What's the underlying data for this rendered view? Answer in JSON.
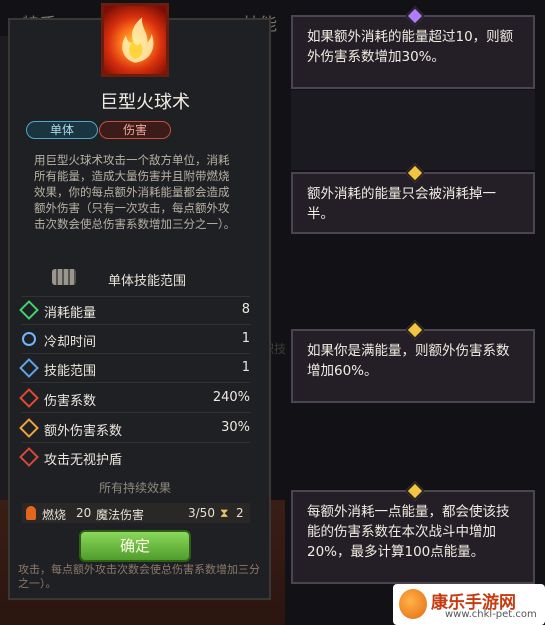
{
  "background": {
    "tab_left": "特质",
    "tab_right": "技能",
    "ghost_text_1": "未次",
    "ghost_text_2": "积技"
  },
  "skill": {
    "icon": "fireball-icon",
    "title": "巨型火球术",
    "tags": [
      "单体",
      "伤害"
    ],
    "description": "用巨型火球术攻击一个敌方单位，消耗所有能量，造成大量伤害并且附带燃烧效果，你的每点额外消耗能量都会造成额外伤害（只有一次攻击，每点额外攻击次数会使总伤害系数增加三分之一）。",
    "range_label": "单体技能范围",
    "stats": [
      {
        "icon": "energy-icon",
        "color": "#3fd46a",
        "label": "消耗能量",
        "value": "8"
      },
      {
        "icon": "cooldown-icon",
        "color": "#6fb6ff",
        "label": "冷却时间",
        "value": "1"
      },
      {
        "icon": "range-icon",
        "color": "#5fa6e8",
        "label": "技能范围",
        "value": "1"
      },
      {
        "icon": "damage-icon",
        "color": "#e24a32",
        "label": "伤害系数",
        "value": "240%"
      },
      {
        "icon": "extra-damage-icon",
        "color": "#f0a43a",
        "label": "额外伤害系数",
        "value": "30%"
      },
      {
        "icon": "ignore-shield-icon",
        "color": "#d8483a",
        "label": "攻击无视护盾",
        "value": ""
      }
    ],
    "persistent_title": "所有持续效果",
    "effect": {
      "name": "燃烧",
      "amount": "20",
      "type": "魔法伤害",
      "duration": "3/50",
      "stacks": "2"
    },
    "confirm_label": "确定",
    "bottom_text": "攻击，每点额外攻击次数会使总伤害系数增加三分之一）。"
  },
  "tooltips": [
    {
      "gem": "purple",
      "text": "如果额外消耗的能量超过10，则额外伤害系数增加30%。"
    },
    {
      "gem": "gold",
      "text": "额外消耗的能量只会被消耗掉一半。"
    },
    {
      "gem": "gold",
      "text": "如果你是满能量，则额外伤害系数增加60%。"
    },
    {
      "gem": "gold",
      "text": "每额外消耗一点能量，都会使该技能的伤害系数在本次战斗中增加20%，最多计算100点能量。"
    }
  ],
  "watermark": {
    "name": "康乐手游网",
    "url": "www.chkl-pet.com"
  }
}
